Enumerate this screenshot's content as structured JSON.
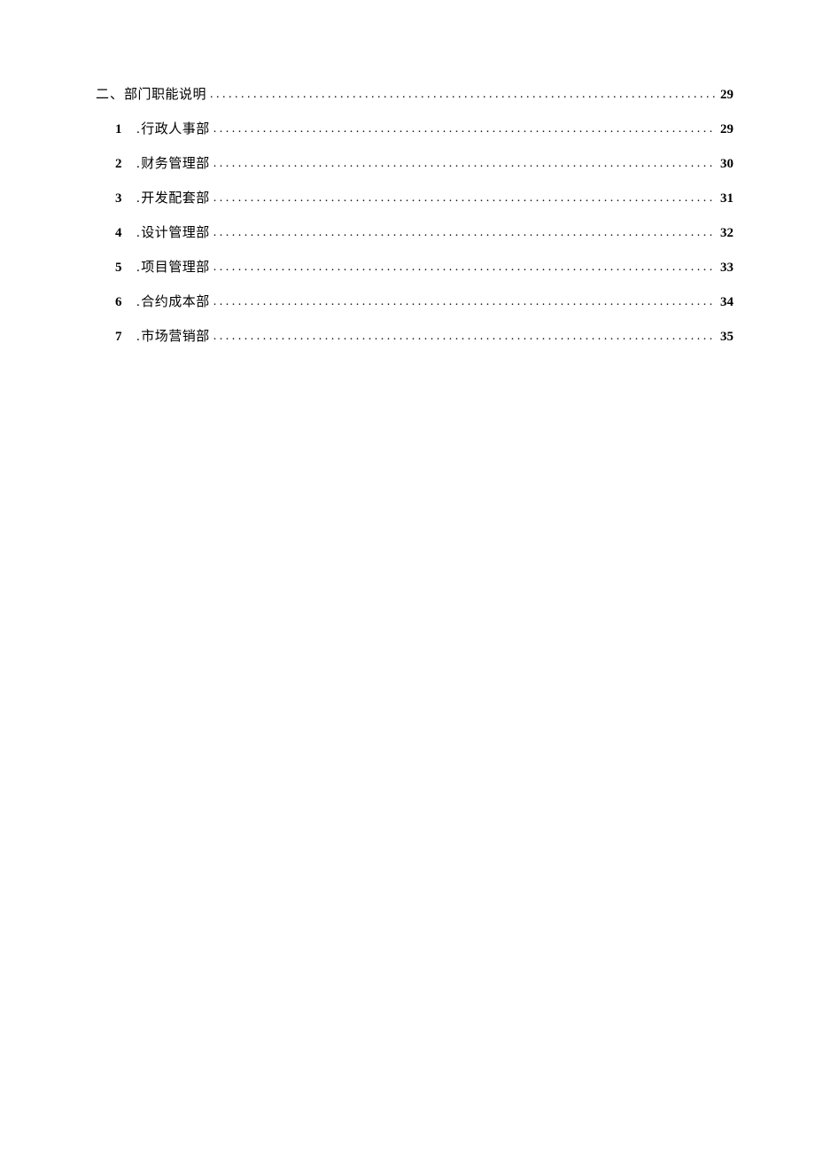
{
  "toc": {
    "heading": {
      "prefix": "二、",
      "title": "部门职能说明",
      "page": "29"
    },
    "items": [
      {
        "num": "1",
        "label": "行政人事部",
        "page": "29"
      },
      {
        "num": "2",
        "label": "财务管理部",
        "page": "30"
      },
      {
        "num": "3",
        "label": "开发配套部",
        "page": "31"
      },
      {
        "num": "4",
        "label": "设计管理部",
        "page": "32"
      },
      {
        "num": "5",
        "label": "项目管理部",
        "page": "33"
      },
      {
        "num": "6",
        "label": "合约成本部",
        "page": "34"
      },
      {
        "num": "7",
        "label": "市场营销部",
        "page": "35"
      }
    ]
  }
}
